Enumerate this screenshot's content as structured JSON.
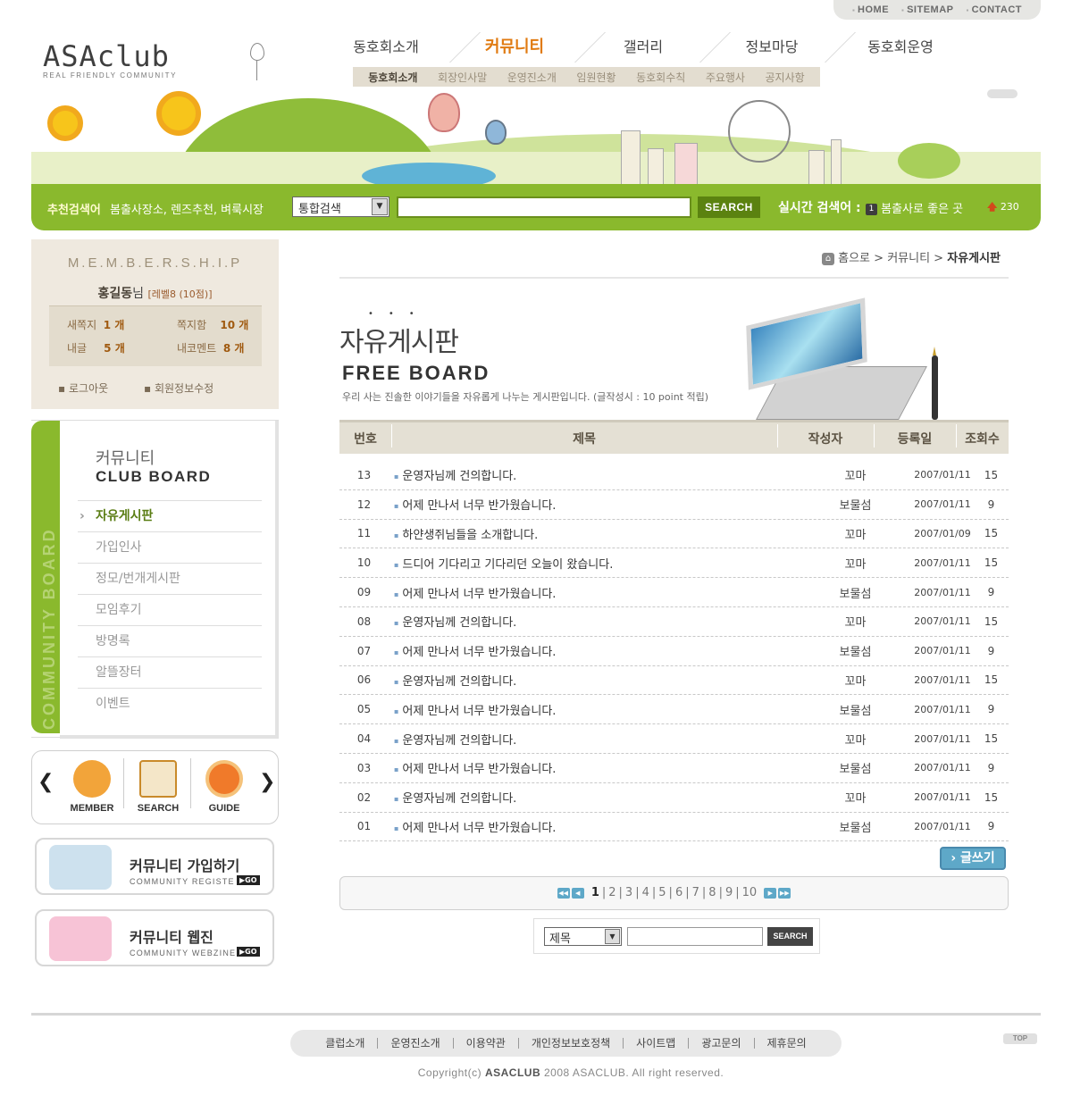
{
  "util_nav": [
    "HOME",
    "SITEMAP",
    "CONTACT"
  ],
  "logo": {
    "name": "ASAclub",
    "tagline": "REAL FRIENDLY COMMUNITY"
  },
  "gnb": {
    "items": [
      "동호회소개",
      "커뮤니티",
      "갤러리",
      "정보마당",
      "동호회운영"
    ],
    "active": "커뮤니티"
  },
  "subnav": {
    "items": [
      "동호회소개",
      "회장인사말",
      "운영진소개",
      "임원현황",
      "동호회수칙",
      "주요행사",
      "공지사항"
    ],
    "active": "동호회소개"
  },
  "search_bar": {
    "label": "추천검색어",
    "recommended": "봄출사장소, 렌즈추천, 벼룩시장",
    "select_value": "통합검색",
    "input_value": "",
    "button": "SEARCH",
    "realtime_label": "실시간 검색어 :",
    "realtime_rank": "1",
    "realtime_value": "봄출사로 좋은 곳",
    "trend_value": "230"
  },
  "membership": {
    "title": "M.E.M.B.E.R.S.H.I.P",
    "user_name": "홍길동",
    "user_suffix": "님",
    "level": "[레벨8 (10점)]",
    "new_note_label": "새쪽지",
    "new_note_value": "1 개",
    "notebox_label": "쪽지함",
    "notebox_value": "10 개",
    "my_posts_label": "내글",
    "my_posts_value": "5 개",
    "my_comments_label": "내코멘트",
    "my_comments_value": "8 개",
    "logout": "로그아웃",
    "edit_info": "회원정보수정"
  },
  "club_board": {
    "side_text": "COMMUNITY BOARD",
    "title_kr": "커뮤니티",
    "title_en": "CLUB BOARD",
    "items": [
      "자유게시판",
      "가입인사",
      "정모/번개게시판",
      "모임후기",
      "방명록",
      "알뜰장터",
      "이벤트"
    ],
    "active": "자유게시판"
  },
  "quick_menu": [
    {
      "label": "MEMBER",
      "icon": "member-icon"
    },
    {
      "label": "SEARCH",
      "icon": "search-doc-icon"
    },
    {
      "label": "GUIDE",
      "icon": "guide-icon"
    }
  ],
  "banners": [
    {
      "title": "커뮤니티 가입하기",
      "sub": "COMMUNITY REGISTE",
      "go": "▶GO"
    },
    {
      "title": "커뮤니티 웹진",
      "sub": "COMMUNITY WEBZINE",
      "go": "▶GO"
    }
  ],
  "breadcrumb": {
    "home": "홈으로",
    "section": "커뮤니티",
    "current": "자유게시판"
  },
  "board_header": {
    "title": "자유게시판",
    "subtitle": "FREE BOARD",
    "description": "우리 사는 진솔한 이야기들을 자유롭게 나누는 게시판입니다. (글작성시 : 10 point 적립)"
  },
  "table": {
    "columns": [
      "번호",
      "제목",
      "작성자",
      "등록일",
      "조회수"
    ],
    "rows": [
      [
        "13",
        "운영자님께 건의합니다.",
        "꼬마",
        "2007/01/11",
        "15"
      ],
      [
        "12",
        "어제 만나서 너무 반가웠습니다.",
        "보물섬",
        "2007/01/11",
        "9"
      ],
      [
        "11",
        "하얀생쥐님들을 소개합니다.",
        "꼬마",
        "2007/01/09",
        "15"
      ],
      [
        "10",
        "드디어 기다리고 기다리던 오늘이 왔습니다.",
        "꼬마",
        "2007/01/11",
        "15"
      ],
      [
        "09",
        "어제 만나서 너무 반가웠습니다.",
        "보물섬",
        "2007/01/11",
        "9"
      ],
      [
        "08",
        "운영자님께 건의합니다.",
        "꼬마",
        "2007/01/11",
        "15"
      ],
      [
        "07",
        "어제 만나서 너무 반가웠습니다.",
        "보물섬",
        "2007/01/11",
        "9"
      ],
      [
        "06",
        "운영자님께 건의합니다.",
        "꼬마",
        "2007/01/11",
        "15"
      ],
      [
        "05",
        "어제 만나서 너무 반가웠습니다.",
        "보물섬",
        "2007/01/11",
        "9"
      ],
      [
        "04",
        "운영자님께 건의합니다.",
        "꼬마",
        "2007/01/11",
        "15"
      ],
      [
        "03",
        "어제 만나서 너무 반가웠습니다.",
        "보물섬",
        "2007/01/11",
        "9"
      ],
      [
        "02",
        "운영자님께 건의합니다.",
        "꼬마",
        "2007/01/11",
        "15"
      ],
      [
        "01",
        "어제 만나서 너무 반가웠습니다.",
        "보물섬",
        "2007/01/11",
        "9"
      ]
    ]
  },
  "write_button": "글쓰기",
  "pagination": {
    "pages": [
      "1",
      "2",
      "3",
      "4",
      "5",
      "6",
      "7",
      "8",
      "9",
      "10"
    ],
    "current": "1"
  },
  "board_search": {
    "select_value": "제목",
    "input_value": "",
    "button": "SEARCH"
  },
  "footer": {
    "links": [
      "클럽소개",
      "운영진소개",
      "이용약관",
      "개인정보보호정책",
      "사이트맵",
      "광고문의",
      "제휴문의"
    ],
    "top": "TOP",
    "copyright_prefix": "Copyright(c)",
    "copyright_brand": "ASACLUB",
    "copyright_suffix": "2008 ASACLUB. All right reserved."
  },
  "colors": {
    "accent_green": "#8ab92d",
    "accent_orange": "#e07a10",
    "beige": "#efe9df",
    "link_blue": "#5ea8c8"
  }
}
